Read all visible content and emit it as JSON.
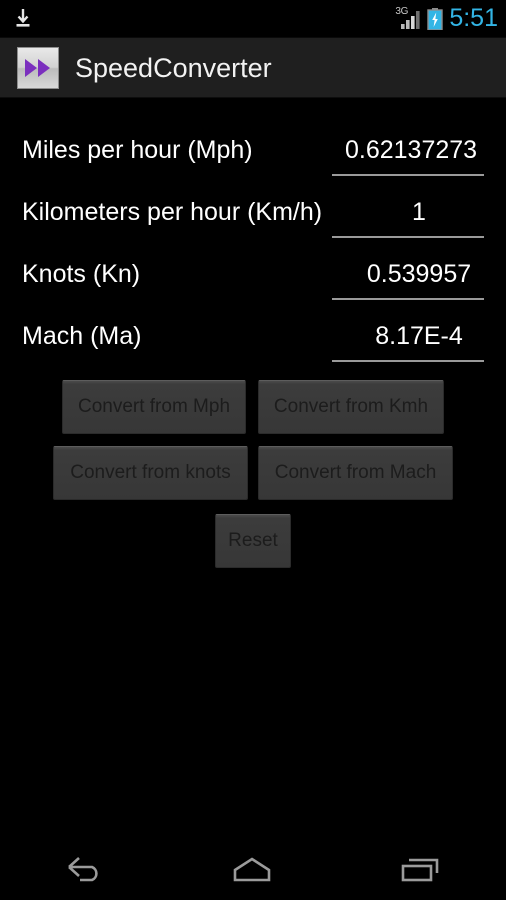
{
  "status_bar": {
    "download_icon": "download-icon",
    "network_label": "3G",
    "signal_icon": "signal-bars-icon",
    "battery_icon": "battery-charging-icon",
    "clock": "5:51",
    "clock_color": "#33b5e5"
  },
  "action_bar": {
    "app_icon": "fast-forward-icon",
    "title": "SpeedConverter",
    "background": "#1f1f1f",
    "icon_accent": "#7B2FBE"
  },
  "conversions": [
    {
      "label": "Miles per hour (Mph)",
      "value": "0.62137273",
      "clipped": true
    },
    {
      "label": "Kilometers per hour (Km/h)",
      "value": "1",
      "clipped": false
    },
    {
      "label": "Knots (Kn)",
      "value": "0.539957",
      "clipped": false
    },
    {
      "label": "Mach (Ma)",
      "value": "8.17E-4",
      "clipped": false
    }
  ],
  "buttons": {
    "convert_from_mph": "Convert from Mph",
    "convert_from_kmh": "Convert from Kmh",
    "convert_from_knots": "Convert from knots",
    "convert_from_mach": "Convert from Mach",
    "reset": "Reset"
  },
  "nav_bar": {
    "back": "back-icon",
    "home": "home-icon",
    "recents": "recent-apps-icon"
  }
}
